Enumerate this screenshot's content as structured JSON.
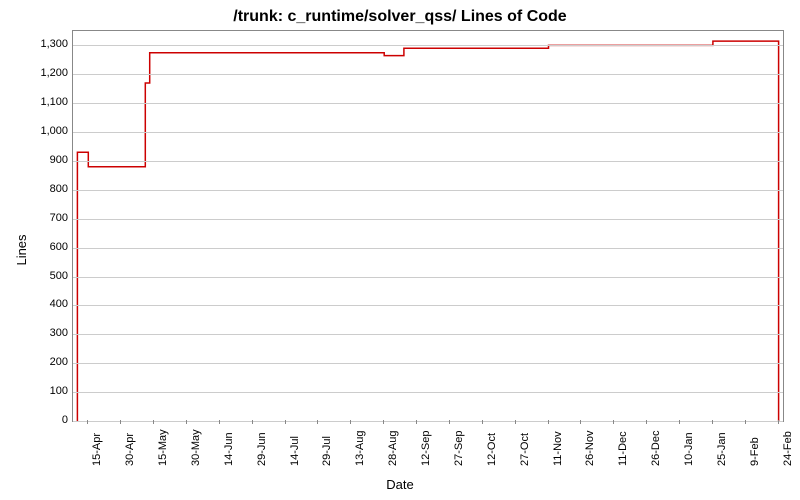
{
  "chart_data": {
    "type": "line",
    "title": "/trunk: c_runtime/solver_qss/ Lines of Code",
    "xlabel": "Date",
    "ylabel": "Lines",
    "ylim": [
      0,
      1350
    ],
    "y_ticks": [
      0,
      100,
      200,
      300,
      400,
      500,
      600,
      700,
      800,
      900,
      1000,
      1100,
      1200,
      1300
    ],
    "x_ticks": [
      "15-Apr",
      "30-Apr",
      "15-May",
      "30-May",
      "14-Jun",
      "29-Jun",
      "14-Jul",
      "29-Jul",
      "13-Aug",
      "28-Aug",
      "12-Sep",
      "27-Sep",
      "12-Oct",
      "27-Oct",
      "11-Nov",
      "26-Nov",
      "11-Dec",
      "26-Dec",
      "10-Jan",
      "25-Jan",
      "9-Feb",
      "24-Feb"
    ],
    "series": [
      {
        "name": "Lines of Code",
        "color": "#cc0000",
        "points": [
          {
            "x": "10-Apr",
            "y": 0
          },
          {
            "x": "10-Apr",
            "y": 930
          },
          {
            "x": "15-Apr",
            "y": 930
          },
          {
            "x": "15-Apr",
            "y": 880
          },
          {
            "x": "11-May",
            "y": 880
          },
          {
            "x": "11-May",
            "y": 1170
          },
          {
            "x": "13-May",
            "y": 1170
          },
          {
            "x": "13-May",
            "y": 1275
          },
          {
            "x": "28-Aug",
            "y": 1275
          },
          {
            "x": "28-Aug",
            "y": 1265
          },
          {
            "x": "6-Sep",
            "y": 1265
          },
          {
            "x": "6-Sep",
            "y": 1290
          },
          {
            "x": "11-Nov",
            "y": 1290
          },
          {
            "x": "11-Nov",
            "y": 1300
          },
          {
            "x": "25-Jan",
            "y": 1300
          },
          {
            "x": "25-Jan",
            "y": 1315
          },
          {
            "x": "24-Feb",
            "y": 1315
          },
          {
            "x": "24-Feb",
            "y": 0
          }
        ]
      }
    ]
  }
}
